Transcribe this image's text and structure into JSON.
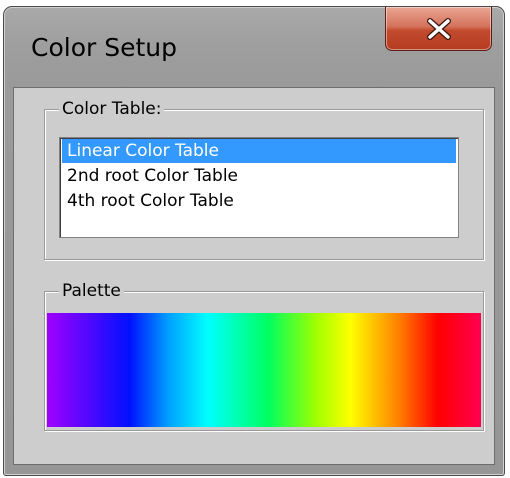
{
  "window": {
    "title": "Color Setup",
    "close_icon": "close-x-icon"
  },
  "color_table": {
    "label": "Color Table:",
    "items": [
      {
        "label": "Linear Color Table",
        "selected": true
      },
      {
        "label": "2nd root Color Table",
        "selected": false
      },
      {
        "label": "4th root Color Table",
        "selected": false
      }
    ]
  },
  "palette": {
    "label": "Palette",
    "gradient_stops": [
      {
        "color": "#a000ff",
        "position": 0
      },
      {
        "color": "#0010ff",
        "position": 19
      },
      {
        "color": "#00a0ff",
        "position": 28
      },
      {
        "color": "#00ffff",
        "position": 37
      },
      {
        "color": "#00ff60",
        "position": 51
      },
      {
        "color": "#a0ff00",
        "position": 62
      },
      {
        "color": "#ffff00",
        "position": 70
      },
      {
        "color": "#ff8000",
        "position": 81
      },
      {
        "color": "#ff0000",
        "position": 90
      },
      {
        "color": "#ff0050",
        "position": 100
      }
    ]
  }
}
